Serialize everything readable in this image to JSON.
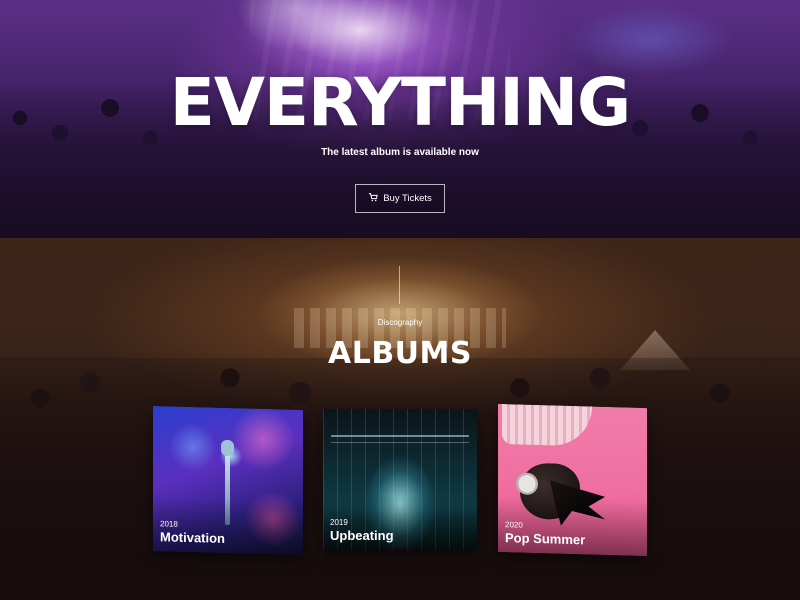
{
  "hero": {
    "title": "EVERYTHING",
    "subtitle": "The latest album is available now",
    "button_label": "Buy Tickets",
    "button_icon": "cart-icon"
  },
  "albums_section": {
    "kicker": "Discography",
    "title": "ALBUMS",
    "albums": [
      {
        "year": "2018",
        "name": "Motivation"
      },
      {
        "year": "2019",
        "name": "Upbeating"
      },
      {
        "year": "2020",
        "name": "Pop Summer"
      }
    ]
  },
  "colors": {
    "hero_tint": "#5b2f86",
    "albums_tint": "#3e2518",
    "text": "#ffffff"
  }
}
